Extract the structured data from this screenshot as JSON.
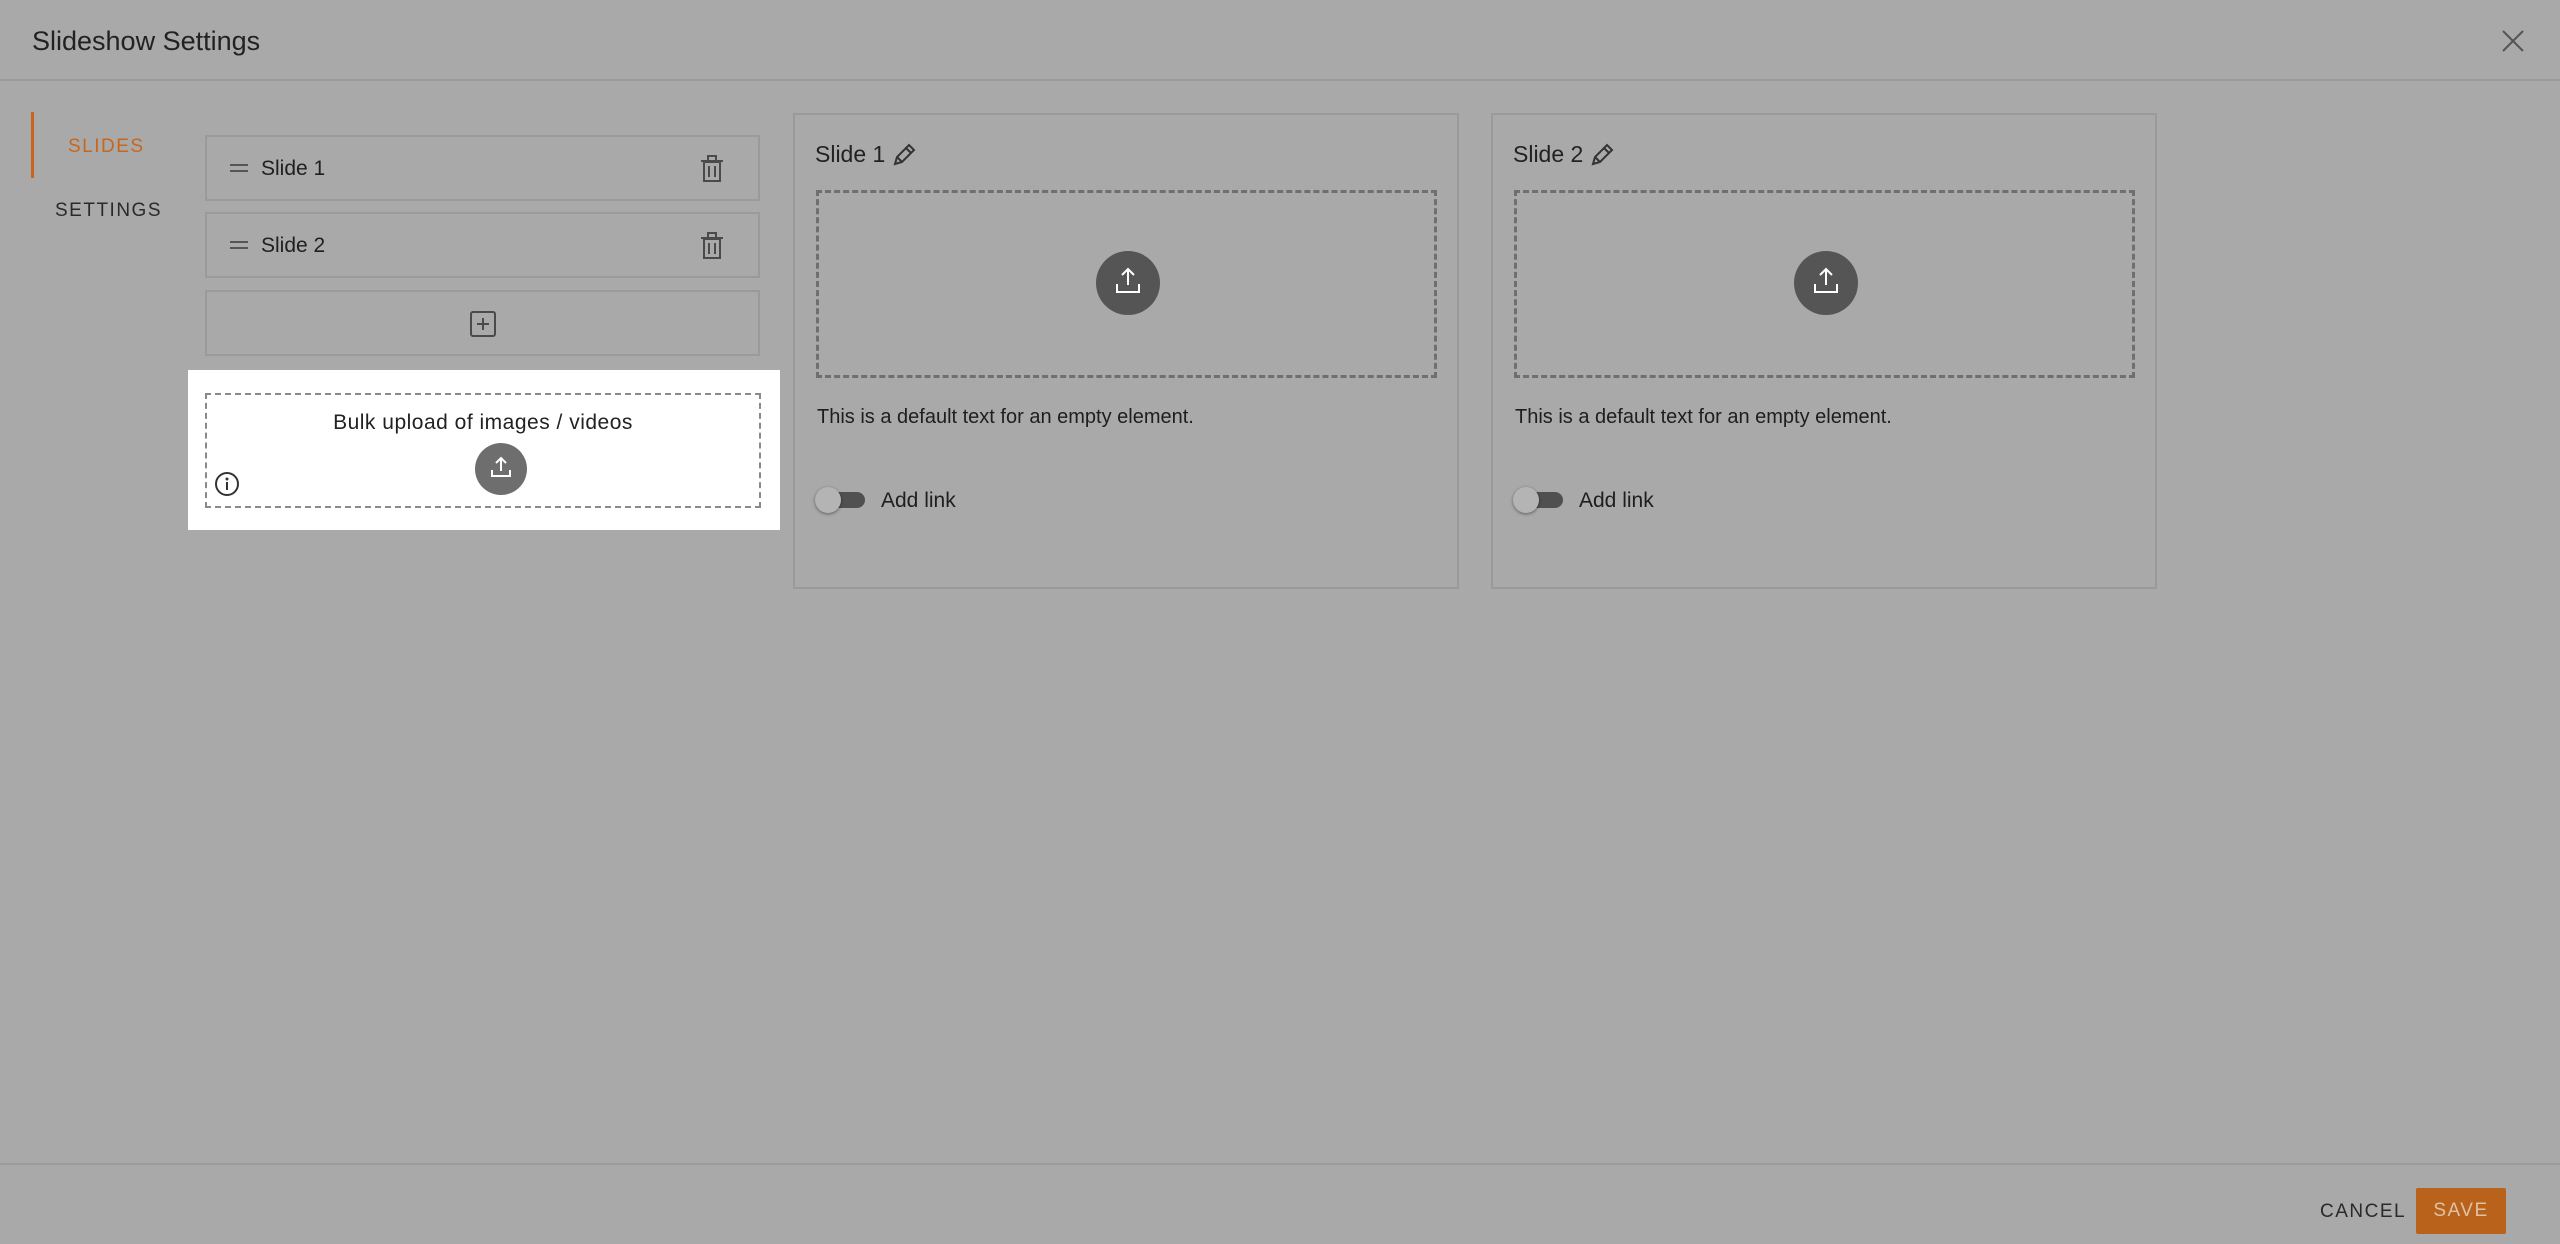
{
  "dialog": {
    "title": "Slideshow Settings"
  },
  "nav": {
    "items": [
      {
        "label": "SLIDES",
        "active": true
      },
      {
        "label": "SETTINGS",
        "active": false
      }
    ]
  },
  "slides": [
    {
      "name": "Slide 1"
    },
    {
      "name": "Slide 2"
    }
  ],
  "bulk_upload": {
    "label": "Bulk upload of images / videos"
  },
  "cards": [
    {
      "title": "Slide 1",
      "default_text": "This is a default text for an empty element.",
      "link_label": "Add link",
      "link_enabled": false
    },
    {
      "title": "Slide 2",
      "default_text": "This is a default text for an empty element.",
      "link_label": "Add link",
      "link_enabled": false
    }
  ],
  "footer": {
    "cancel_label": "CANCEL",
    "save_label": "SAVE"
  },
  "colors": {
    "accent": "#c8671c",
    "overlay_bg": "#a9a9a9",
    "highlight_bg": "#ffffff",
    "save_bg": "#b8621b"
  },
  "icons": [
    "close-icon",
    "drag-handle-icon",
    "trash-icon",
    "plus-square-icon",
    "upload-icon",
    "info-icon",
    "pencil-icon"
  ]
}
